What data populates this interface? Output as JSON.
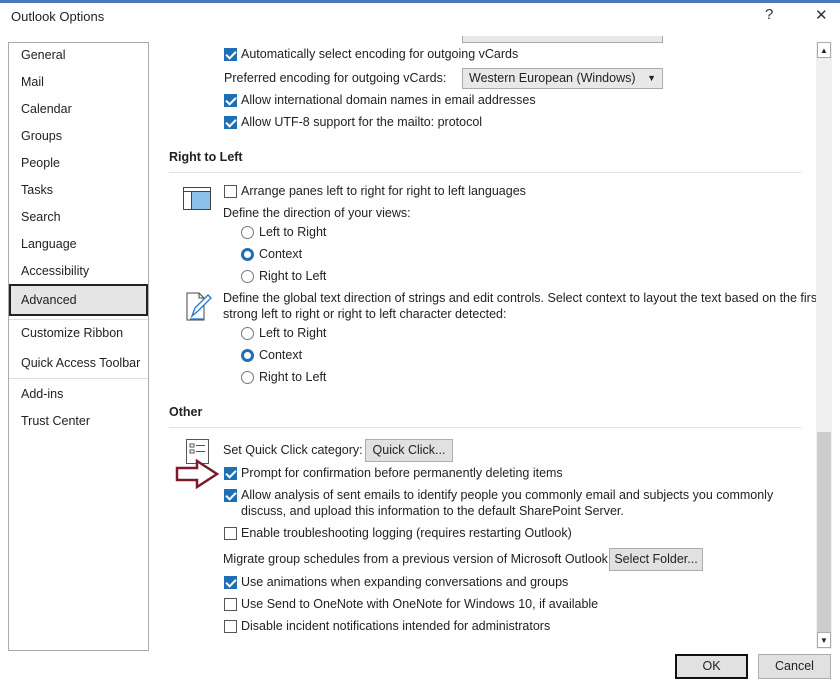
{
  "window": {
    "title": "Outlook Options",
    "help": "?",
    "close": "✕"
  },
  "sidebar": {
    "items": [
      {
        "label": "General"
      },
      {
        "label": "Mail"
      },
      {
        "label": "Calendar"
      },
      {
        "label": "Groups"
      },
      {
        "label": "People"
      },
      {
        "label": "Tasks"
      },
      {
        "label": "Search"
      },
      {
        "label": "Language"
      },
      {
        "label": "Accessibility"
      },
      {
        "label": "Advanced",
        "selected": true
      },
      {
        "label": "Customize Ribbon"
      },
      {
        "label": "Quick Access Toolbar"
      },
      {
        "label": "Add-ins"
      },
      {
        "label": "Trust Center"
      }
    ]
  },
  "top": {
    "auto_encoding": "Automatically select encoding for outgoing vCards",
    "auto_encoding_checked": true,
    "pref_label": "Preferred encoding for outgoing vCards:",
    "pref_value": "Western European (Windows)",
    "intl_domain": "Allow international domain names in email addresses",
    "intl_checked": true,
    "utf8": "Allow UTF-8 support for the mailto: protocol",
    "utf8_checked": true
  },
  "rtl": {
    "header": "Right to Left",
    "arrange": "Arrange panes left to right for right to left languages",
    "arrange_checked": false,
    "views_label": "Define the direction of your views:",
    "views_options": [
      "Left to Right",
      "Context",
      "Right to Left"
    ],
    "views_selected": "Context",
    "global_label_1": "Define the global text direction of strings and edit controls. Select context to layout the text based on the first",
    "global_label_2": "strong left to right or right to left character detected:",
    "global_options": [
      "Left to Right",
      "Context",
      "Right to Left"
    ],
    "global_selected": "Context"
  },
  "other": {
    "header": "Other",
    "quick_label": "Set Quick Click category:",
    "quick_btn": "Quick Click...",
    "prompt": "Prompt for confirmation before permanently deleting items",
    "prompt_checked": true,
    "analysis_1": "Allow analysis of sent emails to identify people you commonly email and subjects you commonly",
    "analysis_2": "discuss, and upload this information to the default SharePoint Server.",
    "analysis_checked": true,
    "logging": "Enable troubleshooting logging (requires restarting Outlook)",
    "logging_checked": false,
    "migrate_label": "Migrate group schedules from a previous version of Microsoft Outlook:",
    "migrate_btn": "Select Folder...",
    "animations": "Use animations when expanding conversations and groups",
    "animations_checked": true,
    "onenote": "Use Send to OneNote with OneNote for Windows 10, if available",
    "onenote_checked": false,
    "incident": "Disable incident notifications intended for administrators",
    "incident_checked": false
  },
  "footer": {
    "ok": "OK",
    "cancel": "Cancel"
  },
  "colors": {
    "accent": "#1f6fb5",
    "arrow": "#7a1a2a"
  }
}
